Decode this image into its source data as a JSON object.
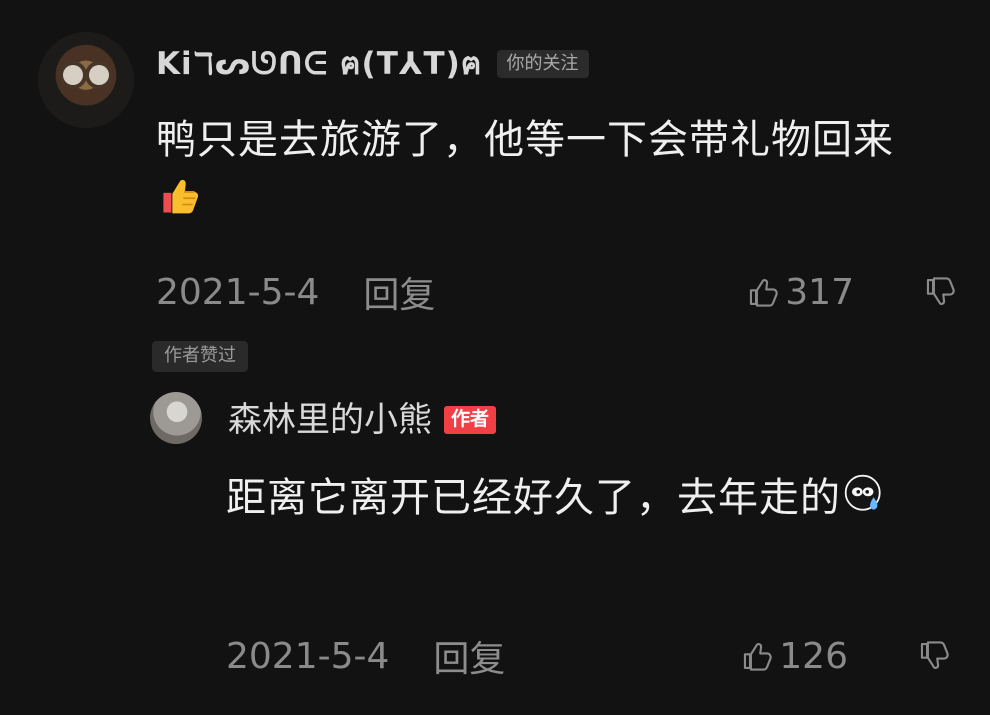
{
  "comments": [
    {
      "username": "Kiℸᔕᘎᑎᕮ ฅ(T⅄T)ฅ",
      "relationship_badge": "你的关注",
      "text": "鸭只是去旅游了，他等一下会带礼物回来",
      "emoji": "thumbs-up-icon",
      "date": "2021-5-4",
      "reply_label": "回复",
      "like_count": "317",
      "author_liked_label": "作者赞过"
    },
    {
      "username": "森林里的小熊",
      "author_badge": "作者",
      "text": "距离它离开已经好久了，去年走的",
      "emoji": "crying-face-icon",
      "date": "2021-5-4",
      "reply_label": "回复",
      "like_count": "126"
    }
  ],
  "colors": {
    "background": "#121212",
    "primary_text": "#efefef",
    "secondary_text": "#8a8a8a",
    "author_badge": "#f13f46"
  }
}
